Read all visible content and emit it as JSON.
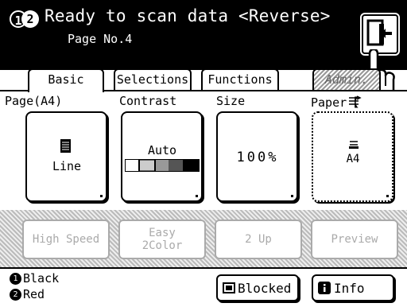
{
  "header": {
    "drum1": "1",
    "drum2": "2",
    "status": "Ready to scan data <Reverse>",
    "page": "Page No.4"
  },
  "tabs": [
    "Basic",
    "Selections",
    "Functions",
    "Admin."
  ],
  "settings": [
    {
      "label": "Page(A4)",
      "value": "Line"
    },
    {
      "label": "Contrast",
      "value": "Auto"
    },
    {
      "label": "Size",
      "value": "100%"
    },
    {
      "label": "Paper【",
      "value": "A4"
    }
  ],
  "modes": [
    "High Speed",
    "Easy\n2Color",
    "2 Up",
    "Preview"
  ],
  "footer": {
    "ink1_num": "1",
    "ink1": "Black",
    "ink2_num": "2",
    "ink2": "Red",
    "blocked": "Blocked",
    "info": "Info"
  },
  "colors": {
    "header_bg": "#000000",
    "disabled_text": "#aaaaaa"
  }
}
